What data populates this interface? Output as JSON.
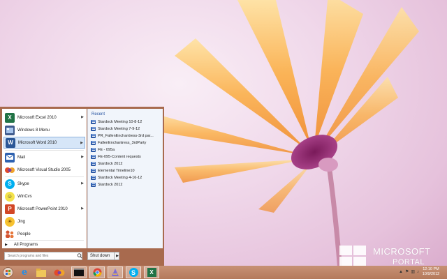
{
  "start_menu": {
    "programs": [
      {
        "label": "Microsoft Excel 2010",
        "icon": "excel-icon",
        "has_arrow": true
      },
      {
        "label": "Windows 8 Menu",
        "icon": "windows8-menu-icon",
        "has_arrow": false
      },
      {
        "label": "Microsoft Word 2010",
        "icon": "word-icon",
        "has_arrow": true
      },
      {
        "label": "Mail",
        "icon": "mail-icon",
        "has_arrow": true
      },
      {
        "label": "Microsoft Visual Studio 2005",
        "icon": "visual-studio-icon",
        "has_arrow": false
      },
      {
        "label": "Skype",
        "icon": "skype-icon",
        "has_arrow": true
      },
      {
        "label": "WinCvs",
        "icon": "wincvs-icon",
        "has_arrow": false
      },
      {
        "label": "Microsoft PowerPoint 2010",
        "icon": "powerpoint-icon",
        "has_arrow": true
      },
      {
        "label": "Jing",
        "icon": "jing-icon",
        "has_arrow": false
      },
      {
        "label": "People",
        "icon": "people-icon",
        "has_arrow": false
      }
    ],
    "all_programs_label": "All Programs",
    "search_placeholder": "Search programs and files",
    "shutdown_label": "Shut down",
    "recent_title": "Recent",
    "recent_items": [
      "Stardock Meeting 10-8-12",
      "Stardock Meeting 7-9-12",
      "PR_FallenEnchantress-3rd par...",
      "FallenEnchantress_3rdParty",
      "FE - 095a",
      "FE-095-Content requests",
      "Stardock 2012",
      "Elemental Timeline10",
      "Stardock Meeting 4-16-12",
      "Stardock 2012"
    ]
  },
  "taskbar": {
    "clock_time": "12:10 PM",
    "clock_date": "10/9/2012"
  },
  "watermark": {
    "line1": "MICROSOFT",
    "line2": "PORTAL"
  },
  "colors": {
    "accent": "#a86a4e",
    "taskbar": "#c0876a",
    "selection": "#d6e6f8"
  }
}
